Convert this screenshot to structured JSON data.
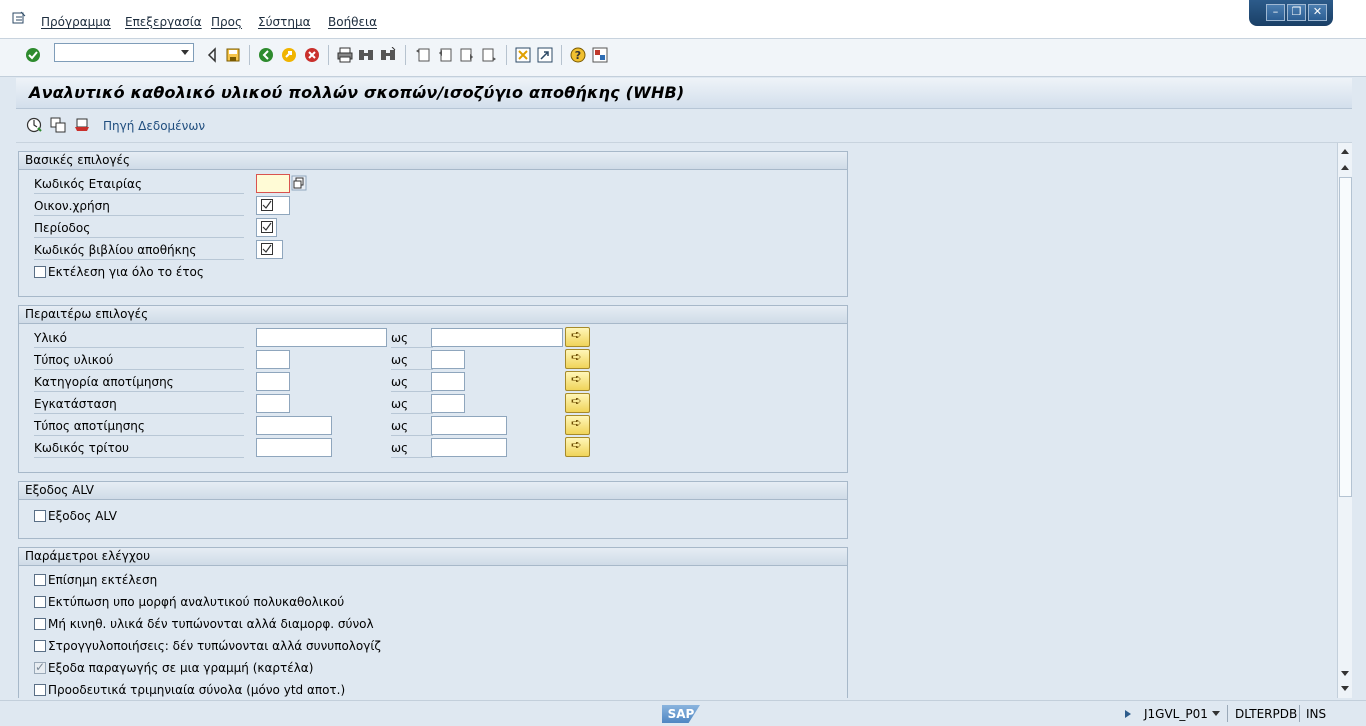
{
  "menu": {
    "items": [
      "Πρόγραμμα",
      "Επεξεργασία",
      "Προς",
      "Σύστημα",
      "Βοήθεια"
    ]
  },
  "toolbar": {
    "command_field": "",
    "icons": [
      "enter-icon",
      "back-icon",
      "save-icon",
      "back-green-icon",
      "exit-icon",
      "cancel-icon",
      "print-icon",
      "find-icon",
      "find-next-icon",
      "first-page-icon",
      "prev-page-icon",
      "next-page-icon",
      "last-page-icon",
      "create-session-icon",
      "shortcut-icon",
      "help-icon",
      "customize-icon"
    ]
  },
  "title": "Αναλυτικό καθολικό υλικού πολλών σκοπών/ισοζύγιο αποθήκης (WHB)",
  "app_toolbar": {
    "data_source_label": "Πηγή Δεδομένων"
  },
  "basic": {
    "header": "Βασικές επιλογές",
    "company_code_label": "Κωδικός Εταιρίας",
    "company_code_value": "",
    "fiscal_year_label": "Οικον.χρήση",
    "period_label": "Περίοδος",
    "warehouse_book_label": "Κωδικός βιβλίου αποθήκης",
    "whole_year_label": "Εκτέλεση για όλο το έτος",
    "whole_year_checked": false
  },
  "further": {
    "header": "Περαιτέρω επιλογές",
    "to_label": "ως",
    "rows": [
      {
        "label": "Υλικό",
        "from": "",
        "to": ""
      },
      {
        "label": "Τύπος υλικού",
        "from": "",
        "to": ""
      },
      {
        "label": "Κατηγορία αποτίμησης",
        "from": "",
        "to": ""
      },
      {
        "label": "Εγκατάσταση",
        "from": "",
        "to": ""
      },
      {
        "label": "Τύπος αποτίμησης",
        "from": "",
        "to": ""
      },
      {
        "label": "Κωδικός τρίτου",
        "from": "",
        "to": ""
      }
    ]
  },
  "alv": {
    "header": "Εξοδος ALV",
    "label": "Εξοδος ALV",
    "checked": false
  },
  "control": {
    "header": "Παράμετροι ελέγχου",
    "items": [
      {
        "label": "Επίσημη εκτέλεση",
        "checked": false,
        "disabled": false
      },
      {
        "label": "Εκτύπωση υπο μορφή αναλυτικού πολυκαθολικού",
        "checked": false,
        "disabled": false
      },
      {
        "label": "Μή κινηθ. υλικά δέν τυπώνονται αλλά διαμορφ. σύνολ",
        "checked": false,
        "disabled": false
      },
      {
        "label": "Στρογγυλοποιήσεις: δέν τυπώνονται αλλά συνυπολογίζ",
        "checked": false,
        "disabled": false
      },
      {
        "label": "Εξοδα παραγωγής σε μια γραμμή (καρτέλα)",
        "checked": true,
        "disabled": true
      },
      {
        "label": "Προοδευτικά τριμηνιαία σύνολα (μόνο ytd αποτ.)",
        "checked": false,
        "disabled": false
      }
    ]
  },
  "status": {
    "logo": "SAP",
    "transaction": "J1GVL_P01",
    "system": "DLTERPDB",
    "mode": "INS"
  },
  "colors": {
    "background": "#dfe8f1",
    "required_field": "#fffbd6",
    "multi_select": "#f0d45a"
  }
}
